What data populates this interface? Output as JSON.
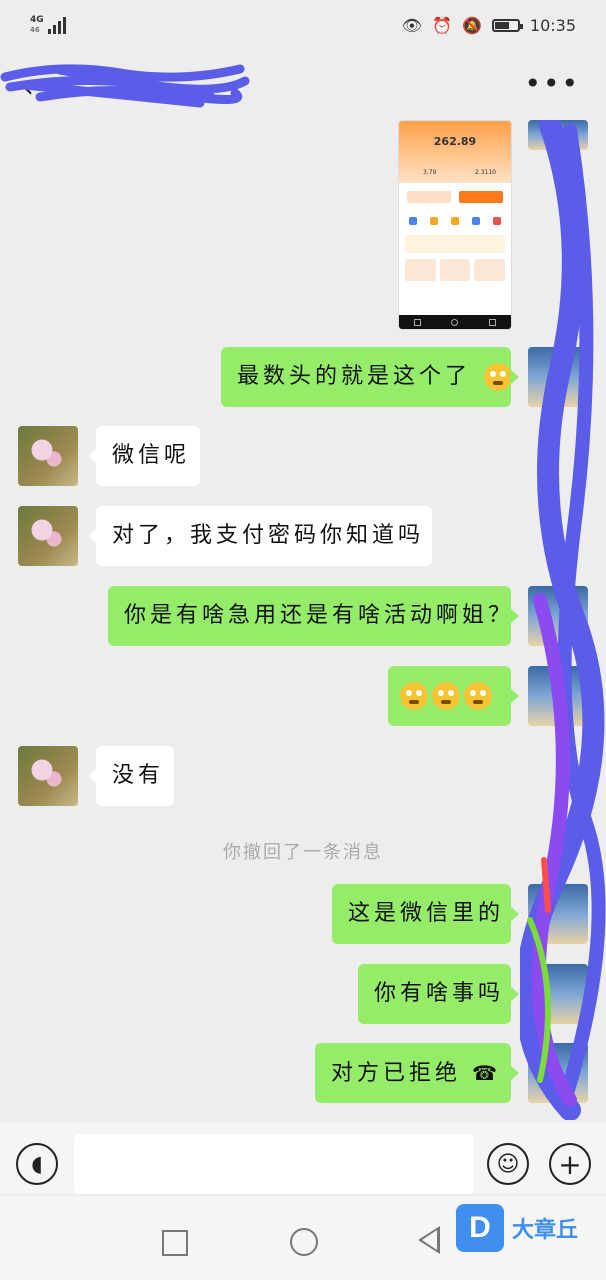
{
  "status_bar": {
    "network": "4G",
    "network_sub": "46",
    "time": "10:35"
  },
  "header": {
    "title": ""
  },
  "messages": {
    "m1": "最数头的就是这个了",
    "m2": "微信呢",
    "m3": "对了，我支付密码你知道吗",
    "m4": "你是有啥急用还是有啥活动啊姐？",
    "m6": "没有",
    "m7": "这是微信里的",
    "m8": "你有啥事吗",
    "m9": "对方已拒绝"
  },
  "system_note": "你撤回了一条消息",
  "screenshot": {
    "amount": "262.89",
    "left_value": "3.79",
    "right_value": "2.3110"
  },
  "watermark": {
    "text": "大章丘"
  },
  "colors": {
    "bubble_self": "#95ec69",
    "bubble_other": "#ffffff",
    "background": "#ededed",
    "scribble": "#5b5ce8"
  }
}
